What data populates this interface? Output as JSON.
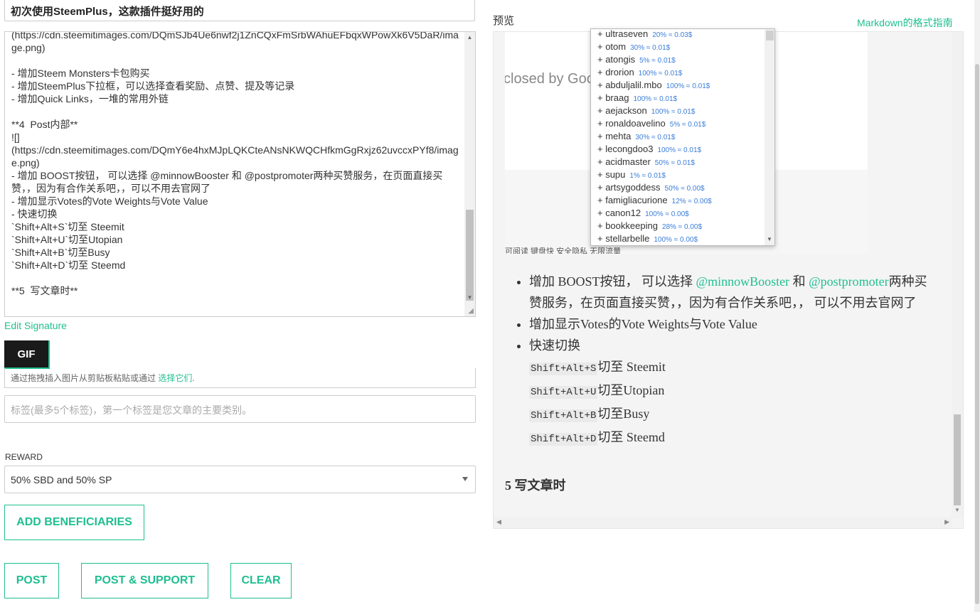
{
  "title": "初次使用SteemPlus，这款插件挺好用的",
  "editor_lines": [
    "(https://cdn.steemitimages.com/DQmSJb4Ue6nwf2j1ZnCQxFmSrbWAhuEFbqxWPowXk6V5DaR/image.png)",
    "",
    "- 增加Steem Monsters卡包购买",
    "- 增加SteemPlus下拉框，可以选择查看奖励、点赞、提及等记录",
    "- 增加Quick Links，一堆的常用外链",
    "",
    "**4  Post内部**",
    "![]",
    "(https://cdn.steemitimages.com/DQmY6e4hxMJpLQKCteANsNKWQCHfkmGgRxjz62uvccxPYf8/image.png)",
    "- 增加 BOOST按钮， 可以选择 @minnowBooster 和 @postpromoter两种买赞服务，在页面直接买赞，，因为有合作关系吧，，可以不用去官网了",
    "- 增加显示Votes的Vote Weights与Vote Value",
    "- 快速切换",
    "`Shift+Alt+S`切至 Steemit",
    "`Shift+Alt+U`切至Utopian",
    "`Shift+Alt+B`切至Busy",
    "`Shift+Alt+D`切至 Steemd",
    "",
    "**5  写文章时**"
  ],
  "edit_signature": "Edit Signature",
  "gif_button": "GIF",
  "dropzone": {
    "text": "通过拖拽插入图片从剪贴板粘贴或通过 ",
    "link": "选择它们",
    "suffix": "."
  },
  "tags_placeholder": "标签(最多5个标签)，第一个标签是您文章的主要类别。",
  "reward": {
    "label": "REWARD",
    "selected": "50% SBD and 50% SP"
  },
  "buttons": {
    "add_beneficiaries": "ADD BENEFICIARIES",
    "post": "POST",
    "post_support": "POST & SUPPORT",
    "clear": "CLEAR"
  },
  "preview": {
    "label": "预览",
    "markdown_guide": "Markdown的格式指南",
    "image_caption": "closed by Goo",
    "image_bottom_text": "可阅读    键盘快   安全隐私   无限流量",
    "items": [
      {
        "t1": "增加 BOOST按钮， 可以选择 ",
        "link1": "@minnowBooster",
        "t2": " 和 ",
        "link2": "@postpromoter",
        "t3": "两种买赞服务，在页面直接买赞，，因为有合作关系吧，， 可以不用去官网了"
      },
      {
        "text": "增加显示Votes的Vote Weights与Vote Value"
      },
      {
        "text": "快速切换",
        "shortcuts": [
          {
            "key": "Shift+Alt+S",
            "target": "切至 Steemit"
          },
          {
            "key": "Shift+Alt+U",
            "target": "切至Utopian"
          },
          {
            "key": "Shift+Alt+B",
            "target": "切至Busy"
          },
          {
            "key": "Shift+Alt+D",
            "target": "切至 Steemd"
          }
        ]
      }
    ],
    "heading": "5 写文章时"
  },
  "voters": [
    {
      "name": "+ ultraseven",
      "pct": "20% ≈ 0.03$"
    },
    {
      "name": "+ otom",
      "pct": "30% ≈ 0.01$"
    },
    {
      "name": "+ atongis",
      "pct": "5% ≈ 0.01$"
    },
    {
      "name": "+ drorion",
      "pct": "100% ≈ 0.01$"
    },
    {
      "name": "+ abduljalil.mbo",
      "pct": "100% ≈ 0.01$"
    },
    {
      "name": "+ braag",
      "pct": "100% ≈ 0.01$"
    },
    {
      "name": "+ aejackson",
      "pct": "100% ≈ 0.01$"
    },
    {
      "name": "+ ronaldoavelino",
      "pct": "5% ≈ 0.01$"
    },
    {
      "name": "+ mehta",
      "pct": "30% ≈ 0.01$"
    },
    {
      "name": "+ lecongdoo3",
      "pct": "100% ≈ 0.01$"
    },
    {
      "name": "+ acidmaster",
      "pct": "50% ≈ 0.01$"
    },
    {
      "name": "+ supu",
      "pct": "1% ≈ 0.01$"
    },
    {
      "name": "+ artsygoddess",
      "pct": "50% ≈ 0.00$"
    },
    {
      "name": "+ famigliacurione",
      "pct": "12% ≈ 0.00$"
    },
    {
      "name": "+ canon12",
      "pct": "100% ≈ 0.00$"
    },
    {
      "name": "+ bookkeeping",
      "pct": "28% ≈ 0.00$"
    },
    {
      "name": "+ stellarbelle",
      "pct": "100% ≈ 0.00$"
    }
  ],
  "colors": {
    "accent": "#1fbf8f",
    "dark_button": "#1a1a1a",
    "vote_pct": "#3b7dd8"
  }
}
